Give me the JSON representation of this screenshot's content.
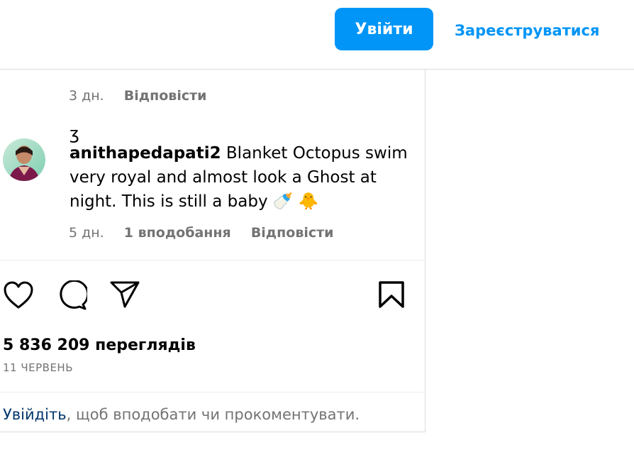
{
  "header": {
    "login_label": "Увійти",
    "signup_label": "Зареєструватися",
    "accent_color": "#0095f6"
  },
  "previous_comment": {
    "time": "3 дн.",
    "reply_label": "Відповісти"
  },
  "comment": {
    "username": "anithapedapati2",
    "text": "Blanket Octopus swim very royal and almost look a Ghost at night. This is still a baby 🍼 🐥",
    "time": "5 дн.",
    "likes": "1 вподобання",
    "reply_label": "Відповісти"
  },
  "actions": {
    "like_icon": "heart-icon",
    "comment_icon": "comment-icon",
    "share_icon": "send-icon",
    "save_icon": "bookmark-icon"
  },
  "stats": {
    "views": "5 836 209 переглядів",
    "date": "11 ЧЕРВЕНЬ"
  },
  "login_prompt": {
    "link_text": "Увійдіть",
    "rest_text": ", щоб вподобати чи прокоментувати."
  }
}
